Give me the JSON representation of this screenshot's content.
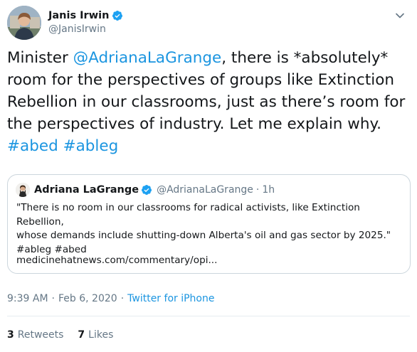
{
  "author": {
    "display_name": "Janis Irwin",
    "handle": "@JanisIrwin",
    "verified": true
  },
  "tweet": {
    "segments": [
      {
        "text": "Minister ",
        "type": "text"
      },
      {
        "text": "@AdrianaLaGrange",
        "type": "mention"
      },
      {
        "text": ", there is *absolutely* room for the perspectives of groups like Extinction Rebellion in our classrooms, just as there’s room for the perspectives of industry. Let me explain why. ",
        "type": "text"
      },
      {
        "text": "#abed",
        "type": "hashtag"
      },
      {
        "text": " ",
        "type": "text"
      },
      {
        "text": "#ableg",
        "type": "hashtag"
      }
    ]
  },
  "quote": {
    "display_name": "Adriana LaGrange",
    "handle": "@AdrianaLaGrange",
    "separator": "·",
    "time": "1h",
    "verified": true,
    "text_lines": [
      "\"There is no room in our classrooms for radical activists, like Extinction Rebellion,",
      "whose demands include shutting-down Alberta's oil and gas sector by 2025.\"",
      "#ableg #abed"
    ],
    "link": "medicinehatnews.com/commentary/opi..."
  },
  "meta": {
    "time": "9:39 AM",
    "separator": "·",
    "date": "Feb 6, 2020",
    "source": "Twitter for iPhone"
  },
  "stats": {
    "retweets_count": "3",
    "retweets_label": "Retweets",
    "likes_count": "7",
    "likes_label": "Likes"
  },
  "colors": {
    "link": "#1b95e0",
    "verified": "#1da1f2",
    "secondary_text": "#657786",
    "border": "#ccd6dd"
  },
  "icons": {
    "verified": "verified-badge-icon",
    "caret": "chevron-down-icon"
  }
}
